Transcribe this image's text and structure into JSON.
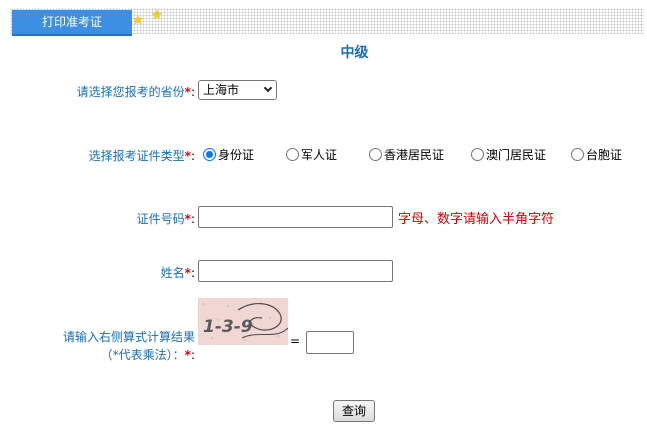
{
  "tabbar": {
    "tab_label": "打印准考证",
    "star_icon": "star-icon"
  },
  "level_title": "中级",
  "form": {
    "province": {
      "label": "请选择您报考的省份",
      "required_mark": "*",
      "colon": ":",
      "selected": "上海市"
    },
    "id_type": {
      "label": "选择报考证件类型",
      "required_mark": "*",
      "colon": ":",
      "options": [
        "身份证",
        "军人证",
        "香港居民证",
        "澳门居民证",
        "台胞证"
      ],
      "selected_index": 0
    },
    "id_number": {
      "label": "证件号码",
      "required_mark": "*",
      "colon": ":",
      "value": "",
      "hint": "字母、数字请输入半角字符"
    },
    "name": {
      "label": "姓名",
      "required_mark": "*",
      "colon": ":",
      "value": ""
    },
    "captcha": {
      "label_line1": "请输入右侧算式计算结果",
      "label_line2": "（*代表乘法）：",
      "required_mark": "*",
      "colon": ":",
      "image_text": "1-3-9",
      "equals": "=",
      "value": ""
    },
    "submit_label": "查询"
  },
  "colors": {
    "tab": "#3c8fe2",
    "label": "#1a6fb3",
    "required": "#e0000a",
    "hint": "#d40000"
  }
}
